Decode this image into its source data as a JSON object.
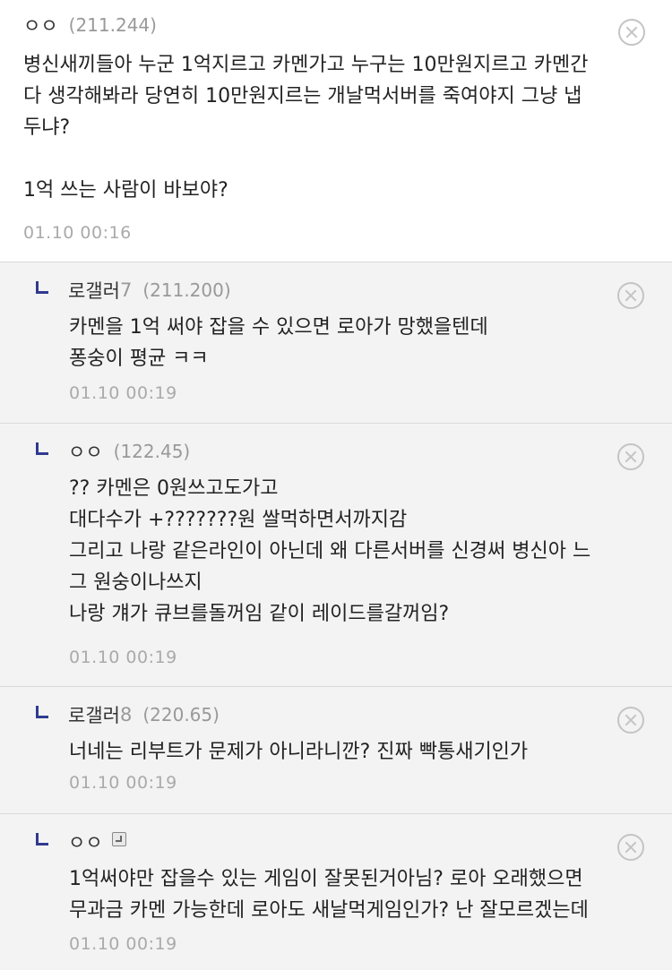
{
  "comments": [
    {
      "nick": "ㅇㅇ",
      "nick_num": "",
      "ip": "(211.244)",
      "text": "병신새끼들아 누군 1억지르고 카멘가고 누구는 10만원지르고 카멘간\n다 생각해봐라 당연히 10만원지르는 개날먹서버를 죽여야지 그냥 냅\n두냐?\n\n1억 쓰는 사람이 바보야?",
      "date": "01.10 00:16"
    },
    {
      "nick": "로갤러",
      "nick_num": "7",
      "ip": "(211.200)",
      "text": "카멘을 1억 써야 잡을 수 있으면 로아가 망했을텐데\n퐁숭이 평균 ㅋㅋ",
      "date": "01.10 00:19"
    },
    {
      "nick": "ㅇㅇ",
      "nick_num": "",
      "ip": "(122.45)",
      "text": "?? 카멘은 0원쓰고도가고\n대다수가 +???????원 쌀먹하면서까지감\n그리고 나랑 같은라인이 아닌데 왜 다른서버를 신경써 병신아 느\n그 원숭이나쓰지\n나랑 걔가 큐브를돌꺼임 같이 레이드를갈꺼임?",
      "date": "01.10 00:19"
    },
    {
      "nick": "로갤러",
      "nick_num": "8",
      "ip": "(220.65)",
      "text": "너네는 리부트가 문제가 아니라니깐? 진짜 빡통새기인가",
      "date": "01.10 00:19"
    },
    {
      "nick": "ㅇㅇ",
      "nick_num": "",
      "ip": "",
      "text": "1억써야만 잡을수 있는 게임이 잘못된거아님? 로아 오래했으면\n무과금 카멘 가능한데 로아도 새날먹게임인가? 난 잘모르겠는데",
      "date": "01.10 00:19"
    }
  ],
  "icons": {
    "reply": "reply-arrow-icon",
    "delete": "delete-x-icon",
    "gallog": "gallog-icon"
  },
  "colors": {
    "reply_marker": "#2f3a8f",
    "reply_bg": "#f3f3f3",
    "meta_gray": "#999999"
  }
}
